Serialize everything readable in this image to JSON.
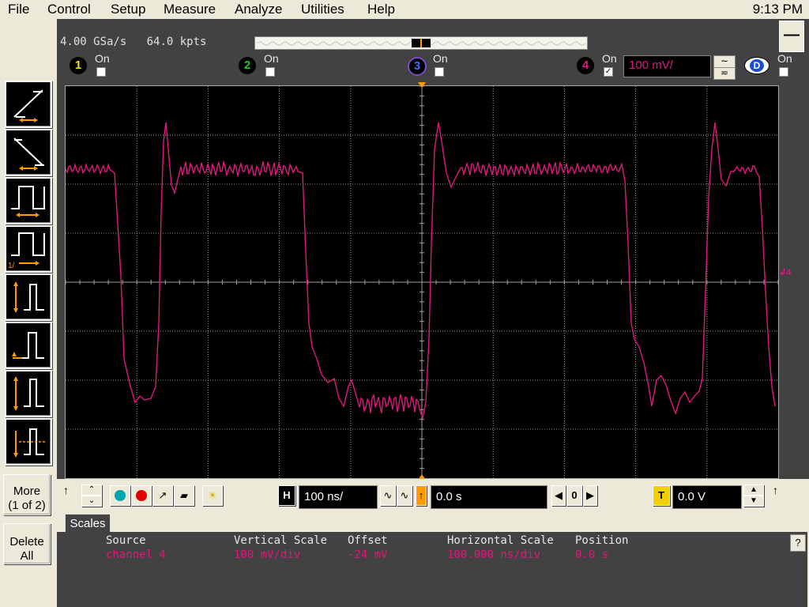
{
  "menu": {
    "items": [
      "File",
      "Control",
      "Setup",
      "Measure",
      "Analyze",
      "Utilities",
      "Help"
    ],
    "clock": "9:13 PM"
  },
  "acquisition": {
    "sample_rate": "4.00 GSa/s",
    "memory_depth": "64.0 kpts"
  },
  "channels": [
    {
      "num": "1",
      "on_label": "On",
      "checked": false,
      "color": "#f2e600"
    },
    {
      "num": "2",
      "on_label": "On",
      "checked": false,
      "color": "#22c822"
    },
    {
      "num": "3",
      "on_label": "On",
      "checked": false,
      "color": "#3a6cff"
    },
    {
      "num": "4",
      "on_label": "On",
      "checked": true,
      "color": "#e0177c",
      "scale": "100 mV/"
    }
  ],
  "digital": {
    "label": "D",
    "on_label": "On",
    "checked": false
  },
  "side_buttons": {
    "more": "More",
    "more_page": "(1 of 2)",
    "delete_line1": "Delete",
    "delete_line2": "All"
  },
  "horizontal": {
    "h_label": "H",
    "scale": "100 ns/",
    "position": "0.0 s",
    "zero": "0"
  },
  "trigger": {
    "t_label": "T",
    "level": "0.0 V",
    "marker": "4"
  },
  "measurements": {
    "tab_label": "Scales",
    "headers": {
      "source": "Source",
      "vscale": "Vertical Scale",
      "offset": "Offset",
      "hscale": "Horizontal Scale",
      "position": "Position"
    },
    "values": {
      "source": "channel 4",
      "vscale": "100 mV/div",
      "offset": "-24 mV",
      "hscale": "100.000 ns/div",
      "position": "0.0 s"
    }
  },
  "help": "?",
  "minimize": "—",
  "colors": {
    "trace": "#e0177c",
    "trigger_orange": "#ff9a00",
    "grid": "#a0a0a0"
  }
}
